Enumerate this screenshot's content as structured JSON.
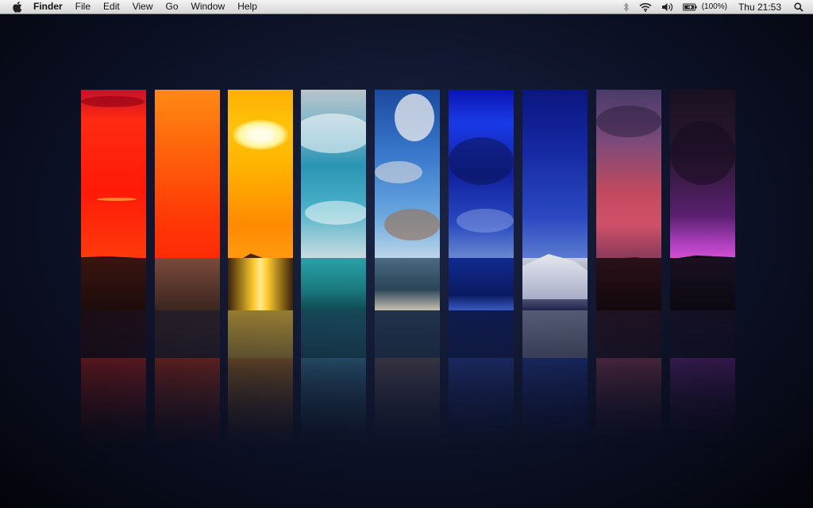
{
  "menubar": {
    "app_name": "Finder",
    "menus": [
      "File",
      "Edit",
      "View",
      "Go",
      "Window",
      "Help"
    ],
    "battery_text": "(100%)",
    "clock": "Thu 21:53",
    "status_icons": [
      "bluetooth-icon",
      "wifi-icon",
      "volume-icon",
      "battery-icon",
      "spotlight-icon"
    ]
  },
  "wallpaper": {
    "panel_colors": [
      "#ff1a10",
      "#ff5a0a",
      "#ffb400",
      "#3aa6c0",
      "#3f7ec8",
      "#1a3fe0",
      "#1b3aa8",
      "#b04a6a",
      "#5a1f6e"
    ]
  }
}
